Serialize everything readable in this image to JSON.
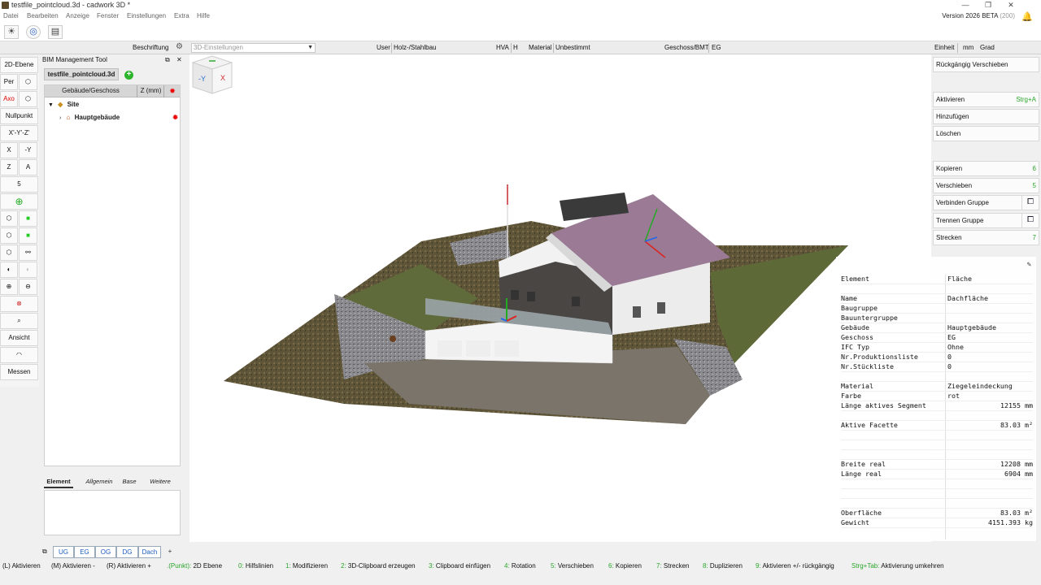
{
  "window": {
    "title": "testfile_pointcloud.3d - cadwork 3D *",
    "controls": [
      "—",
      "❐",
      "✕"
    ]
  },
  "menu": {
    "items": [
      "Datei",
      "Bearbeiten",
      "Anzeige",
      "Fenster",
      "Einstellungen",
      "Extra",
      "Hilfe"
    ],
    "version": "Version 2026 BETA",
    "build": "(200)"
  },
  "optbar": {
    "beschriftung": "Beschriftung",
    "settings_placeholder": "3D-Einstellungen",
    "user_label": "User",
    "user_value": "Holz-/Stahlbau",
    "hva_label": "HVA",
    "hva_value": "H",
    "material_label": "Material",
    "material_value": "Unbestimmt",
    "geschoss_label": "Geschoss/BMT",
    "geschoss_value": "EG",
    "einheit_label": "Einheit",
    "einheit_value": "mm",
    "angle_value": "Grad"
  },
  "lefttools": {
    "ebene": "2D-Ebene",
    "per": "Per",
    "axo": "Axo",
    "nullpunkt": "Nullpunkt",
    "xyz": "X'-Y'-Z'",
    "x": "X",
    "neg_y": "-Y",
    "z": "Z",
    "a": "A",
    "five": "5",
    "ansicht": "Ansicht",
    "messen": "Messen"
  },
  "bim": {
    "header": "BIM Management Tool",
    "file_tab": "testfile_pointcloud.3d",
    "col_building": "Gebäude/Geschoss",
    "col_z": "Z (mm)",
    "site": "Site",
    "building": "Hauptgebäude",
    "tabs": [
      "Element",
      "Allgemein",
      "Base",
      "Weitere"
    ]
  },
  "rightpanel": {
    "undo": "Rückgängig Verschieben",
    "aktivieren": "Aktivieren",
    "aktivieren_sc": "Strg+A",
    "hinzufuegen": "Hinzufügen",
    "loeschen": "Löschen",
    "kopieren": "Kopieren",
    "kopieren_sc": "6",
    "verschieben": "Verschieben",
    "verschieben_sc": "5",
    "verbinden": "Verbinden Gruppe",
    "trennen": "Trennen Gruppe",
    "strecken": "Strecken",
    "strecken_sc": "7"
  },
  "properties": {
    "rows": [
      {
        "k": "Element",
        "v": "Fläche",
        "align": "l"
      },
      {
        "k": "",
        "v": "",
        "align": "l"
      },
      {
        "k": "Name",
        "v": "Dachfläche",
        "align": "l"
      },
      {
        "k": "Baugruppe",
        "v": "",
        "align": "l"
      },
      {
        "k": "Bauuntergruppe",
        "v": "",
        "align": "l"
      },
      {
        "k": "Gebäude",
        "v": "Hauptgebäude",
        "align": "l"
      },
      {
        "k": "Geschoss",
        "v": "EG",
        "align": "l"
      },
      {
        "k": "IFC Typ",
        "v": "Ohne",
        "align": "l"
      },
      {
        "k": "Nr.Produktionsliste",
        "v": "0",
        "align": "l"
      },
      {
        "k": "Nr.Stückliste",
        "v": "0",
        "align": "l"
      },
      {
        "k": "",
        "v": "",
        "align": "l"
      },
      {
        "k": "Material",
        "v": "Ziegeleindeckung",
        "align": "l"
      },
      {
        "k": "Farbe",
        "v": "rot",
        "align": "l"
      },
      {
        "k": "Länge aktives Segment",
        "v": "12155 mm",
        "align": "r"
      },
      {
        "k": "",
        "v": "",
        "align": "l"
      },
      {
        "k": "Aktive Facette",
        "v": "83.03 m²",
        "align": "r"
      },
      {
        "k": "",
        "v": "",
        "align": "l"
      },
      {
        "k": "",
        "v": "",
        "align": "l"
      },
      {
        "k": "",
        "v": "",
        "align": "l"
      },
      {
        "k": "Breite real",
        "v": "12208 mm",
        "align": "r"
      },
      {
        "k": "Länge real",
        "v": "6904 mm",
        "align": "r"
      },
      {
        "k": "",
        "v": "",
        "align": "l"
      },
      {
        "k": "",
        "v": "",
        "align": "l"
      },
      {
        "k": "",
        "v": "",
        "align": "l"
      },
      {
        "k": "Oberfläche",
        "v": "83.03 m²",
        "align": "r"
      },
      {
        "k": "Gewicht",
        "v": "4151.393 kg",
        "align": "r"
      }
    ]
  },
  "floortabs": [
    "UG",
    "EG",
    "OG",
    "DG",
    "Dach",
    "+"
  ],
  "status": [
    {
      "key": "(L)",
      "text": " Aktivieren"
    },
    {
      "key": "(M)",
      "text": " Aktivieren -"
    },
    {
      "key": "(R)",
      "text": " Aktivieren +"
    },
    {
      "key": ".(Punkt):",
      "text": " 2D Ebene"
    },
    {
      "key": "0:",
      "text": " Hilfslinien"
    },
    {
      "key": "1:",
      "text": " Modifizieren"
    },
    {
      "key": "2:",
      "text": " 3D-Clipboard erzeugen"
    },
    {
      "key": "3:",
      "text": " Clipboard einfügen"
    },
    {
      "key": "4:",
      "text": " Rotation"
    },
    {
      "key": "5:",
      "text": " Verschieben"
    },
    {
      "key": "6:",
      "text": " Kopieren"
    },
    {
      "key": "7:",
      "text": " Strecken"
    },
    {
      "key": "8:",
      "text": " Duplizieren"
    },
    {
      "key": "9:",
      "text": " Aktivieren +/- rückgängig"
    },
    {
      "key": "Strg+Tab:",
      "text": " Aktivierung umkehren"
    }
  ],
  "navcube": {
    "y": "-Y",
    "x": "X"
  },
  "colors": {
    "accent_green": "#2aa52a",
    "roof": "#9a7a95",
    "terrain": "#6b5a3a",
    "red_mark": "#e00000"
  }
}
